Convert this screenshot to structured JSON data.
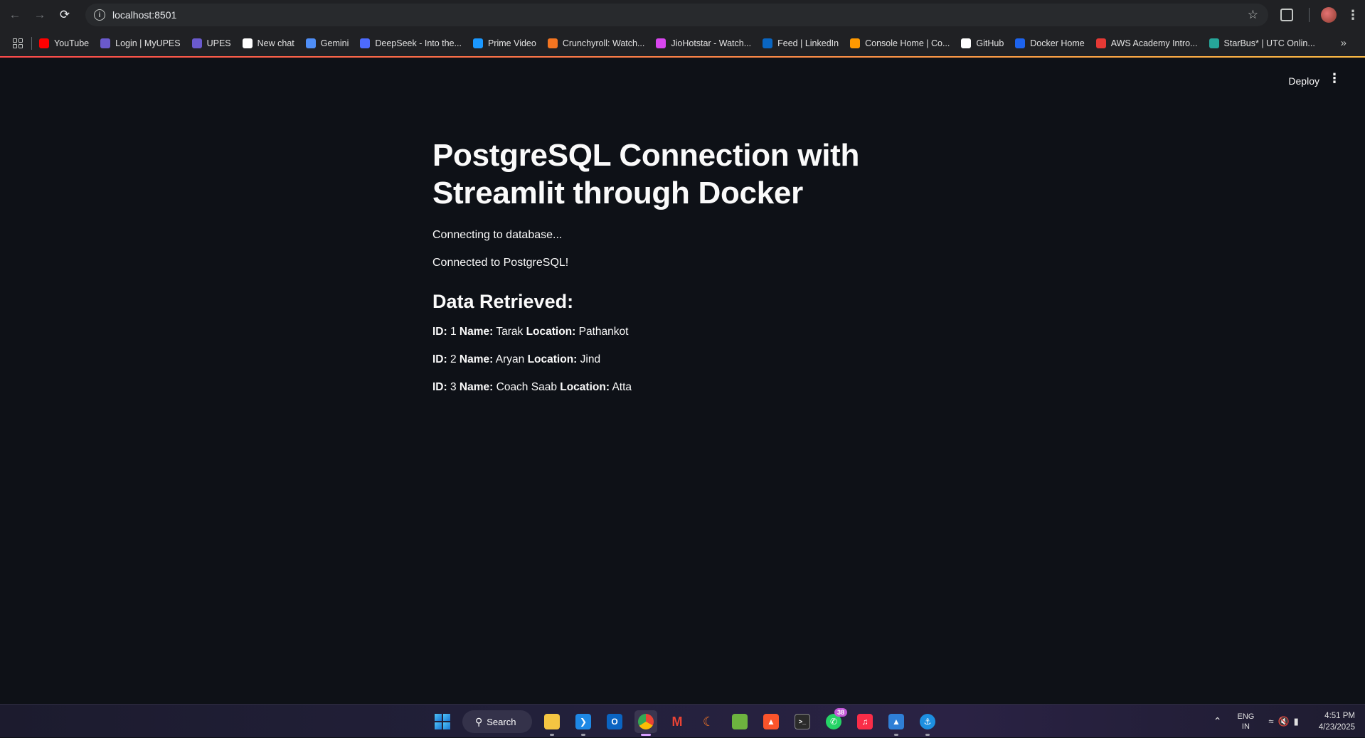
{
  "browser": {
    "url": "localhost:8501",
    "bookmarks": [
      {
        "label": "YouTube",
        "icon": "youtube-icon",
        "color": "#ff0000"
      },
      {
        "label": "Login | MyUPES",
        "icon": "upes-icon",
        "color": "#6a5acd"
      },
      {
        "label": "UPES",
        "icon": "upes-icon",
        "color": "#6a5acd"
      },
      {
        "label": "New chat",
        "icon": "openai-icon",
        "color": "#ffffff"
      },
      {
        "label": "Gemini",
        "icon": "gemini-icon",
        "color": "#4f8ef7"
      },
      {
        "label": "DeepSeek - Into the...",
        "icon": "deepseek-icon",
        "color": "#4d6bfe"
      },
      {
        "label": "Prime Video",
        "icon": "prime-video-icon",
        "color": "#1a98ff"
      },
      {
        "label": "Crunchyroll: Watch...",
        "icon": "crunchyroll-icon",
        "color": "#f47521"
      },
      {
        "label": "JioHotstar - Watch...",
        "icon": "jiohotstar-icon",
        "color": "#d946ef"
      },
      {
        "label": "Feed | LinkedIn",
        "icon": "linkedin-icon",
        "color": "#0a66c2"
      },
      {
        "label": "Console Home | Co...",
        "icon": "aws-console-icon",
        "color": "#ff9900"
      },
      {
        "label": "GitHub",
        "icon": "github-icon",
        "color": "#ffffff"
      },
      {
        "label": "Docker Home",
        "icon": "docker-icon",
        "color": "#1d63ed"
      },
      {
        "label": "AWS Academy Intro...",
        "icon": "aws-academy-icon",
        "color": "#e53935"
      },
      {
        "label": "StarBus* | UTC Onlin...",
        "icon": "starbus-icon",
        "color": "#26a69a"
      }
    ]
  },
  "app": {
    "deploy_label": "Deploy",
    "title": "PostgreSQL Connection with Streamlit through Docker",
    "status_connecting": "Connecting to database...",
    "status_connected": "Connected to PostgreSQL!",
    "subheader": "Data Retrieved:",
    "labels": {
      "id": "ID:",
      "name": "Name:",
      "location": "Location:"
    },
    "records": [
      {
        "id": "1",
        "name": "Tarak",
        "location": "Pathankot"
      },
      {
        "id": "2",
        "name": "Aryan",
        "location": "Jind"
      },
      {
        "id": "3",
        "name": "Coach Saab",
        "location": "Atta"
      }
    ]
  },
  "taskbar": {
    "search_label": "Search",
    "whatsapp_badge": "38",
    "lang_line1": "ENG",
    "lang_line2": "IN",
    "time": "4:51 PM",
    "date": "4/23/2025"
  }
}
